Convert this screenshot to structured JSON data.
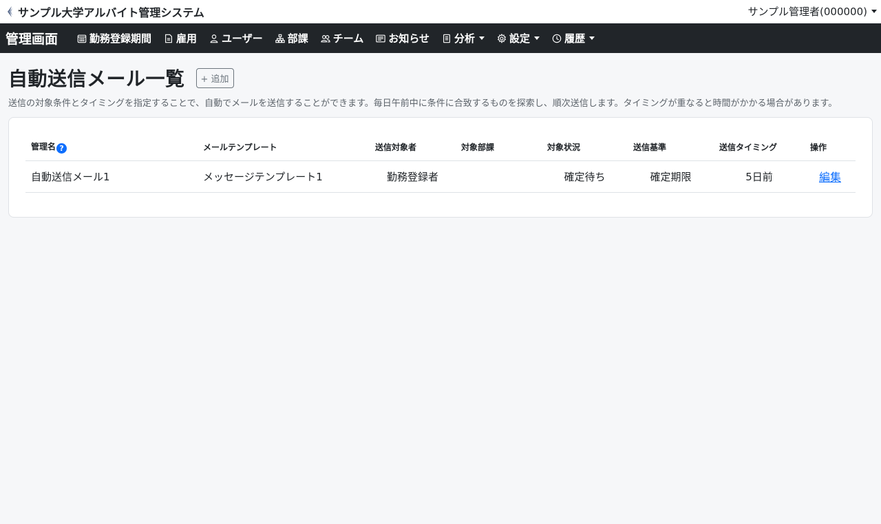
{
  "topbar": {
    "system_title": "サンプル大学アルバイト管理システム",
    "user_label": "サンプル管理者(000000)"
  },
  "navbar": {
    "brand": "管理画面",
    "items": [
      {
        "label": "勤務登録期間",
        "icon": "calendar-icon",
        "dropdown": false
      },
      {
        "label": "雇用",
        "icon": "document-icon",
        "dropdown": false
      },
      {
        "label": "ユーザー",
        "icon": "person-icon",
        "dropdown": false
      },
      {
        "label": "部課",
        "icon": "org-chart-icon",
        "dropdown": false
      },
      {
        "label": "チーム",
        "icon": "people-icon",
        "dropdown": false
      },
      {
        "label": "お知らせ",
        "icon": "newspaper-icon",
        "dropdown": false
      },
      {
        "label": "分析",
        "icon": "report-icon",
        "dropdown": true
      },
      {
        "label": "設定",
        "icon": "gear-icon",
        "dropdown": true
      },
      {
        "label": "履歴",
        "icon": "clock-icon",
        "dropdown": true
      }
    ]
  },
  "page": {
    "title": "自動送信メール一覧",
    "add_label": "+ 追加",
    "description": "送信の対象条件とタイミングを指定することで、自動でメールを送信することができます。毎日午前中に条件に合致するものを探索し、順次送信します。タイミングが重なると時間がかかる場合があります。"
  },
  "table": {
    "headers": [
      "管理名",
      "メールテンプレート",
      "送信対象者",
      "対象部課",
      "対象状況",
      "送信基準",
      "送信タイミング",
      "操作"
    ],
    "help_icon": "?",
    "rows": [
      {
        "name": "自動送信メール1",
        "template": "メッセージテンプレート1",
        "target": "勤務登録者",
        "department": "",
        "status": "確定待ち",
        "basis": "確定期限",
        "timing": "5日前",
        "action": "編集"
      }
    ]
  },
  "colors": {
    "navbar_bg": "#212529",
    "accent": "#0d6efd",
    "page_bg": "#f6f7f9"
  }
}
